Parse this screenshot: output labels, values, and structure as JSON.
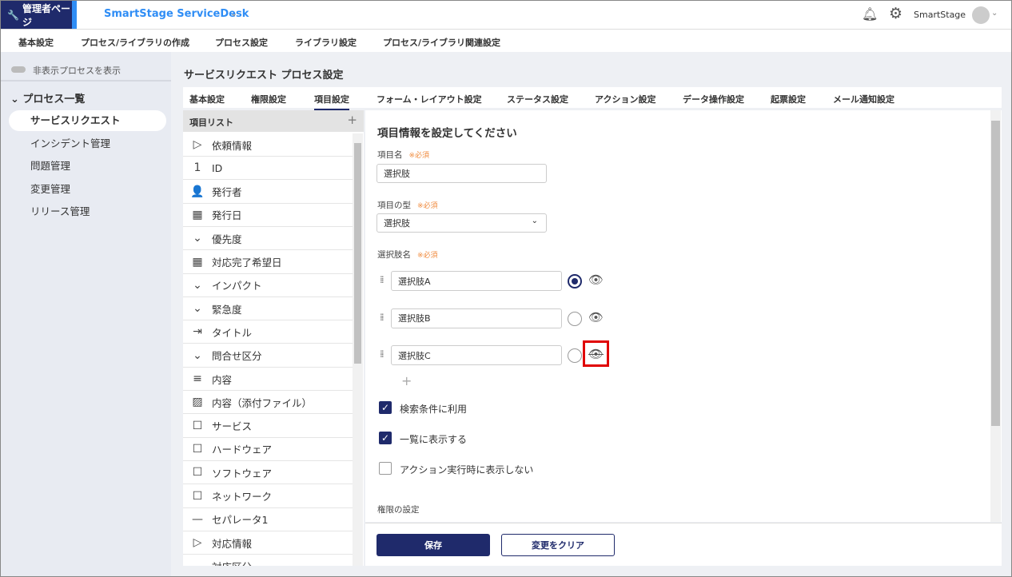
{
  "header": {
    "brand": "管理者ページ",
    "app_title": "SmartStage ServiceDesk",
    "user": "SmartStage"
  },
  "nav": [
    "基本設定",
    "プロセス/ライブラリの作成",
    "プロセス設定",
    "ライブラリ設定",
    "プロセス/ライブラリ関連設定"
  ],
  "sidebar": {
    "toggle_label": "非表示プロセスを表示",
    "section": "プロセス一覧",
    "items": [
      "サービスリクエスト",
      "インシデント管理",
      "問題管理",
      "変更管理",
      "リリース管理"
    ]
  },
  "page_title": "サービスリクエスト プロセス設定",
  "tabs": [
    "基本設定",
    "権限設定",
    "項目設定",
    "フォーム・レイアウト設定",
    "ステータス設定",
    "アクション設定",
    "データ操作設定",
    "起票設定",
    "メール通知設定"
  ],
  "item_list": {
    "title": "項目リスト",
    "add": "+",
    "items": [
      {
        "icon": "label-icon",
        "g": "▷",
        "label": "依頼情報"
      },
      {
        "icon": "number-icon",
        "g": "1",
        "label": "ID"
      },
      {
        "icon": "person-icon",
        "g": "👤",
        "label": "発行者"
      },
      {
        "icon": "calendar-icon",
        "g": "▦",
        "label": "発行日"
      },
      {
        "icon": "dropdown-icon",
        "g": "⌄",
        "label": "優先度"
      },
      {
        "icon": "calendar-icon",
        "g": "▦",
        "label": "対応完了希望日"
      },
      {
        "icon": "dropdown-icon",
        "g": "⌄",
        "label": "インパクト"
      },
      {
        "icon": "dropdown-icon",
        "g": "⌄",
        "label": "緊急度"
      },
      {
        "icon": "text-input-icon",
        "g": "⇥",
        "label": "タイトル"
      },
      {
        "icon": "dropdown-icon",
        "g": "⌄",
        "label": "問合せ区分"
      },
      {
        "icon": "textarea-icon",
        "g": "≡",
        "label": "内容"
      },
      {
        "icon": "image-icon",
        "g": "▨",
        "label": "内容（添付ファイル）"
      },
      {
        "icon": "library-icon",
        "g": "☐",
        "label": "サービス"
      },
      {
        "icon": "library-icon",
        "g": "☐",
        "label": "ハードウェア"
      },
      {
        "icon": "library-icon",
        "g": "☐",
        "label": "ソフトウェア"
      },
      {
        "icon": "library-icon",
        "g": "☐",
        "label": "ネットワーク"
      },
      {
        "icon": "separator-icon",
        "g": "—",
        "label": "セパレータ1"
      },
      {
        "icon": "label-icon",
        "g": "▷",
        "label": "対応情報"
      },
      {
        "icon": "dropdown-icon",
        "g": "⌄",
        "label": "対応区分"
      }
    ]
  },
  "form": {
    "heading": "項目情報を設定してください",
    "required": "※必須",
    "name_label": "項目名",
    "name_value": "選択肢",
    "type_label": "項目の型",
    "type_value": "選択肢",
    "choices_label": "選択肢名",
    "choices": [
      {
        "value": "選択肢A",
        "default": true,
        "visible": true
      },
      {
        "value": "選択肢B",
        "default": false,
        "visible": true
      },
      {
        "value": "選択肢C",
        "default": false,
        "visible": false
      }
    ],
    "add": "+",
    "checks": [
      {
        "label": "検索条件に利用",
        "checked": true
      },
      {
        "label": "一覧に表示する",
        "checked": true
      },
      {
        "label": "アクション実行時に表示しない",
        "checked": false
      }
    ],
    "permission_label": "権限の設定"
  },
  "buttons": {
    "save": "保存",
    "clear": "変更をクリア"
  },
  "colors": {
    "brand": "#1f2a6b",
    "accent": "#2f8df5",
    "required": "#f08a3c",
    "highlight": "#e00000"
  }
}
